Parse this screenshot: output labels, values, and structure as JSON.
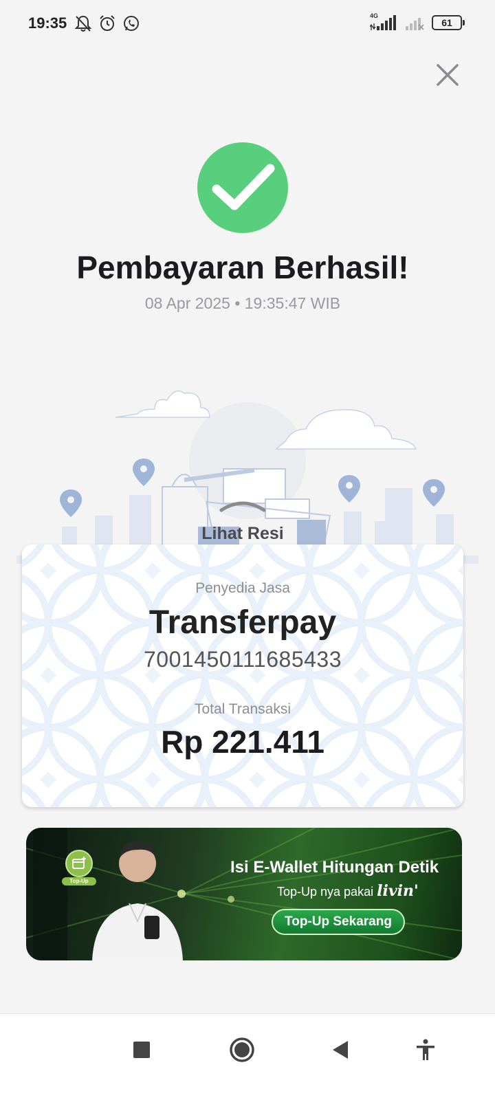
{
  "status_bar": {
    "time": "19:35",
    "network": "4G",
    "battery": "61",
    "icons_left": [
      "bell-off-icon",
      "alarm-icon",
      "whatsapp-icon"
    ],
    "icons_right": [
      "signal-4g-icon",
      "signal-no-service-icon",
      "battery-icon"
    ]
  },
  "header": {
    "close_icon": "close-icon"
  },
  "result": {
    "icon": "checkmark-icon",
    "icon_color": "#58cf7c",
    "title": "Pembayaran Berhasil!",
    "timestamp": "08 Apr 2025 • 19:35:47 WIB"
  },
  "receipt": {
    "toggle_label": "Lihat Resi",
    "toggle_icon": "chevron-up-icon"
  },
  "card": {
    "provider_label": "Penyedia Jasa",
    "provider_name": "Transferpay",
    "account_number": "7001450111685433",
    "total_label": "Total Transaksi",
    "total_amount": "Rp 221.411"
  },
  "banner": {
    "title": "Isi E-Wallet Hitungan Detik",
    "subtitle": "Top-Up nya pakai",
    "brand": "livin'",
    "cta": "Top-Up Sekarang",
    "badge": "Top-Up",
    "badge_icon": "wallet-plus-icon"
  },
  "nav": {
    "recents_icon": "square-icon",
    "home_icon": "circle-home-icon",
    "back_icon": "triangle-back-icon",
    "accessibility_icon": "accessibility-icon"
  }
}
